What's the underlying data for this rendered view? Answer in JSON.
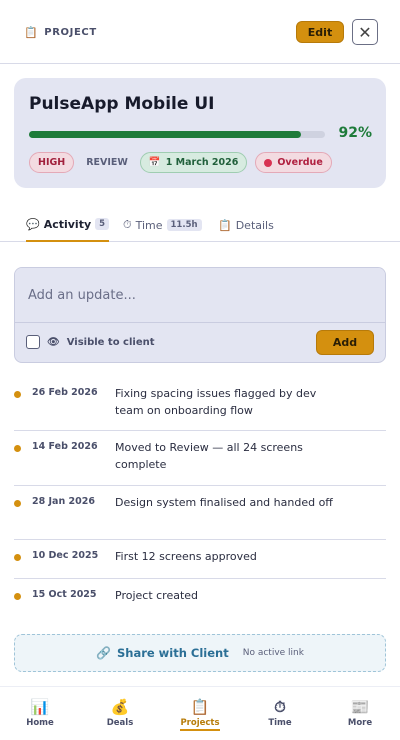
{
  "header": {
    "label": "PROJECT",
    "label_icon": "clipboard-icon",
    "edit_label": "Edit",
    "close_glyph": "✕"
  },
  "project": {
    "title": "PulseApp Mobile UI",
    "progress_percent": 92,
    "progress_label": "92%",
    "priority": "HIGH",
    "status": "REVIEW",
    "due_date": "1 March 2026",
    "overdue_label": "Overdue"
  },
  "tabs": [
    {
      "label": "Activity",
      "count": "5",
      "icon": "chat-icon",
      "active": true
    },
    {
      "label": "Time",
      "count": "11.5h",
      "icon": "stopwatch-icon",
      "active": false
    },
    {
      "label": "Details",
      "icon": "clipboard-icon",
      "active": false
    }
  ],
  "update": {
    "placeholder": "Add an update...",
    "visible_label": "Visible to client",
    "add_label": "Add"
  },
  "activity": [
    {
      "date": "26 Feb 2026",
      "text": "Fixing spacing issues flagged by dev team on onboarding flow"
    },
    {
      "date": "14 Feb 2026",
      "text": "Moved to Review — all 24 screens complete"
    },
    {
      "date": "28 Jan 2026",
      "text": "Design system finalised and handed off"
    },
    {
      "date": "10 Dec 2025",
      "text": "First 12 screens approved"
    },
    {
      "date": "15 Oct 2025",
      "text": "Project created"
    }
  ],
  "share": {
    "label": "Share with Client",
    "sub": "No active link"
  },
  "nav": [
    {
      "label": "Home",
      "icon": "chart-icon",
      "active": false
    },
    {
      "label": "Deals",
      "icon": "money-bag-icon",
      "active": false
    },
    {
      "label": "Projects",
      "icon": "clipboard-icon",
      "active": true
    },
    {
      "label": "Time",
      "icon": "stopwatch-icon",
      "active": false
    },
    {
      "label": "More",
      "icon": "newspaper-icon",
      "active": false
    }
  ],
  "colors": {
    "accent": "#d4900f",
    "progress": "#1e7b3a",
    "danger": "#d83252"
  }
}
